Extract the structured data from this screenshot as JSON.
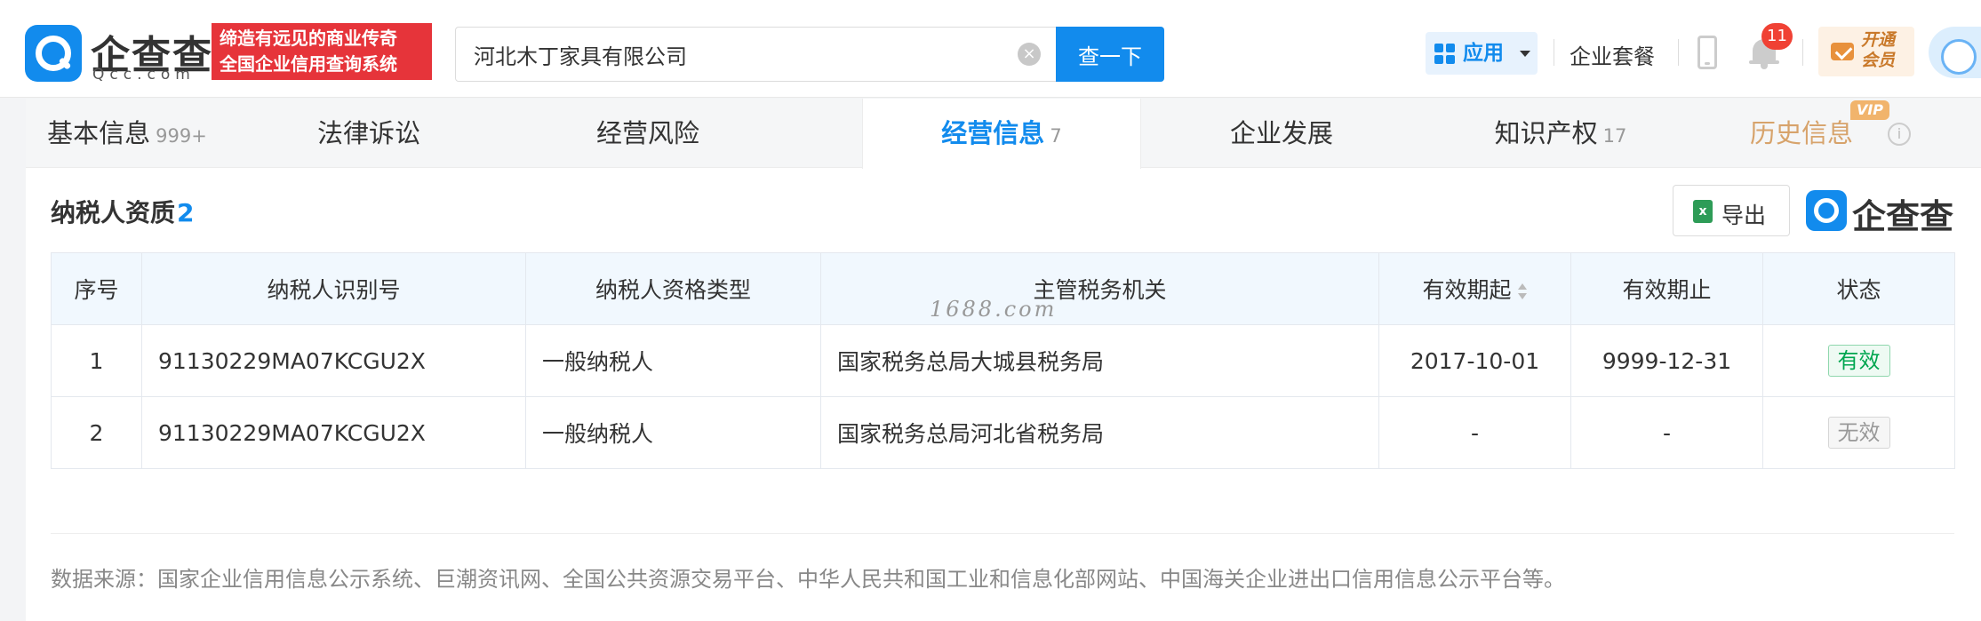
{
  "header": {
    "logo_text": "企查查",
    "logo_sub": "Qcc.com",
    "slogan_line1": "缔造有远见的商业传奇",
    "slogan_line2": "全国企业信用查询系统",
    "search_value": "河北木丁家具有限公司",
    "search_button": "查一下",
    "apps_label": "应用",
    "package_label": "企业套餐",
    "notification_count": "11",
    "vip_label": "开通会员"
  },
  "tabs": [
    {
      "label": "基本信息",
      "count": "999+"
    },
    {
      "label": "法律诉讼",
      "count": ""
    },
    {
      "label": "经营风险",
      "count": ""
    },
    {
      "label": "经营信息",
      "count": "7"
    },
    {
      "label": "企业发展",
      "count": ""
    },
    {
      "label": "知识产权",
      "count": "17"
    },
    {
      "label": "历史信息",
      "count": ""
    }
  ],
  "vip_tag": "VIP",
  "section": {
    "title": "纳税人资质",
    "count": "2",
    "export_label": "导出",
    "brand_text": "企查查"
  },
  "table": {
    "headers": [
      "序号",
      "纳税人识别号",
      "纳税人资格类型",
      "主管税务机关",
      "有效期起",
      "有效期止",
      "状态"
    ],
    "rows": [
      {
        "idx": "1",
        "tax_id": "91130229MA07KCGU2X",
        "type": "一般纳税人",
        "authority": "国家税务总局大城县税务局",
        "start": "2017-10-01",
        "end": "9999-12-31",
        "status": "有效"
      },
      {
        "idx": "2",
        "tax_id": "91130229MA07KCGU2X",
        "type": "一般纳税人",
        "authority": "国家税务总局河北省税务局",
        "start": "-",
        "end": "-",
        "status": "无效"
      }
    ]
  },
  "watermark": "1688.com",
  "data_source": "数据来源：国家企业信用信息公示系统、巨潮资讯网、全国公共资源交易平台、中华人民共和国工业和信息化部网站、中国海关企业进出口信用信息公示平台等。",
  "colors": {
    "accent": "#128bed",
    "slogan_bg": "#e6343a",
    "valid": "#00a650",
    "history": "#d7a36b"
  }
}
